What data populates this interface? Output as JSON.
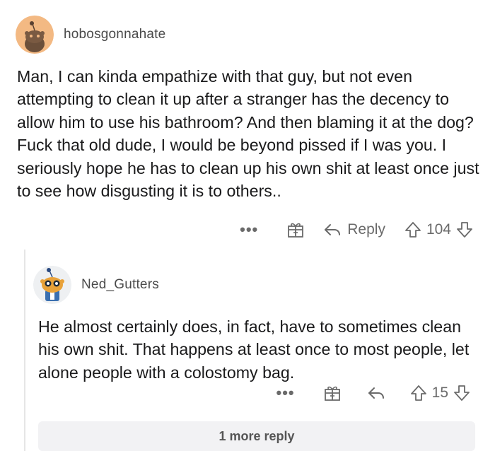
{
  "comment": {
    "username": "hobosgonnahate",
    "avatar_icon": "snoo-avatar-icon",
    "body": "Man, I can kinda empathize with that guy, but not even attempting to clean it up after a stranger has the decency to allow him to use his bathroom? And then blaming it at the dog? Fuck that old dude, I would be beyond pissed if I was you. I seriously hope he has to clean up his own shit at least once just to see how disgusting it is to others..",
    "actions": {
      "more": "•••",
      "award_icon": "gift-icon",
      "reply_icon": "reply-arrow-icon",
      "reply_label": "Reply",
      "upvote_icon": "upvote-arrow-icon",
      "score": "104",
      "downvote_icon": "downvote-arrow-icon"
    }
  },
  "reply": {
    "username": "Ned_Gutters",
    "avatar_icon": "snoo-avatar-icon",
    "body": "He almost certainly does, in fact, have to sometimes clean his own shit. That happens at least once to most people, let alone people with a colostomy bag.",
    "actions": {
      "more": "•••",
      "award_icon": "gift-icon",
      "reply_icon": "reply-arrow-icon",
      "upvote_icon": "upvote-arrow-icon",
      "score": "15",
      "downvote_icon": "downvote-arrow-icon"
    }
  },
  "more_replies": {
    "label": "1 more reply"
  },
  "colors": {
    "text": "#1a1a1b",
    "meta": "#6a6a6a",
    "thread_line": "#e6e6e6",
    "more_bg": "#f2f2f4"
  }
}
